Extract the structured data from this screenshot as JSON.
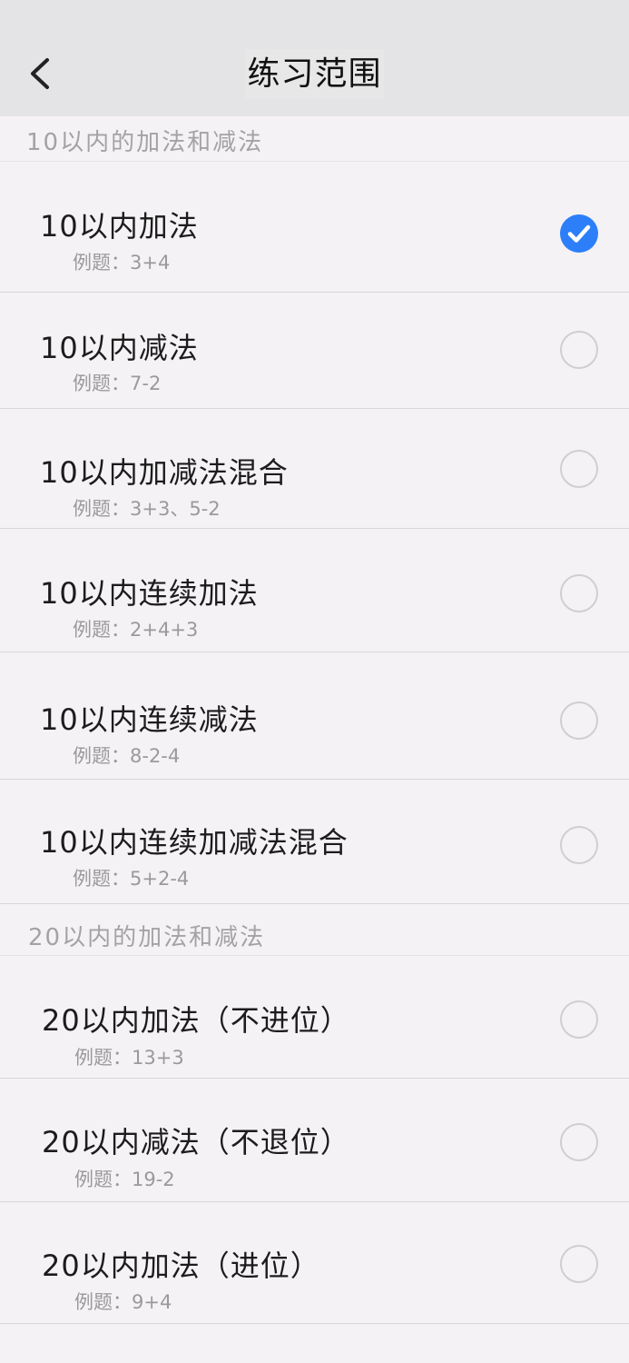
{
  "header": {
    "title": "练习范围",
    "back_icon": "chevron-left-icon"
  },
  "sections": [
    {
      "label": "10以内的加法和减法",
      "items": [
        {
          "title": "10以内加法",
          "example": "例题：3+4",
          "selected": true
        },
        {
          "title": "10以内减法",
          "example": "例题：7-2",
          "selected": false
        },
        {
          "title": "10以内加减法混合",
          "example": "例题：3+3、5-2",
          "selected": false
        },
        {
          "title": "10以内连续加法",
          "example": "例题：2+4+3",
          "selected": false
        },
        {
          "title": "10以内连续减法",
          "example": "例题：8-2-4",
          "selected": false
        },
        {
          "title": "10以内连续加减法混合",
          "example": "例题：5+2-4",
          "selected": false
        }
      ]
    },
    {
      "label": "20以内的加法和减法",
      "items": [
        {
          "title": "20以内加法（不进位）",
          "example": "例题：13+3",
          "selected": false
        },
        {
          "title": "20以内减法（不退位）",
          "example": "例题：19-2",
          "selected": false
        },
        {
          "title": "20以内加法（进位）",
          "example": "例题：9+4",
          "selected": false
        }
      ]
    }
  ],
  "colors": {
    "accent": "#2d7ff9",
    "header_bg": "#e4e3e5",
    "page_bg": "#f5f2f5",
    "section_text": "#a3a3a3",
    "example_text": "#9a9a9a",
    "radio_off": "#cfcfcf"
  }
}
